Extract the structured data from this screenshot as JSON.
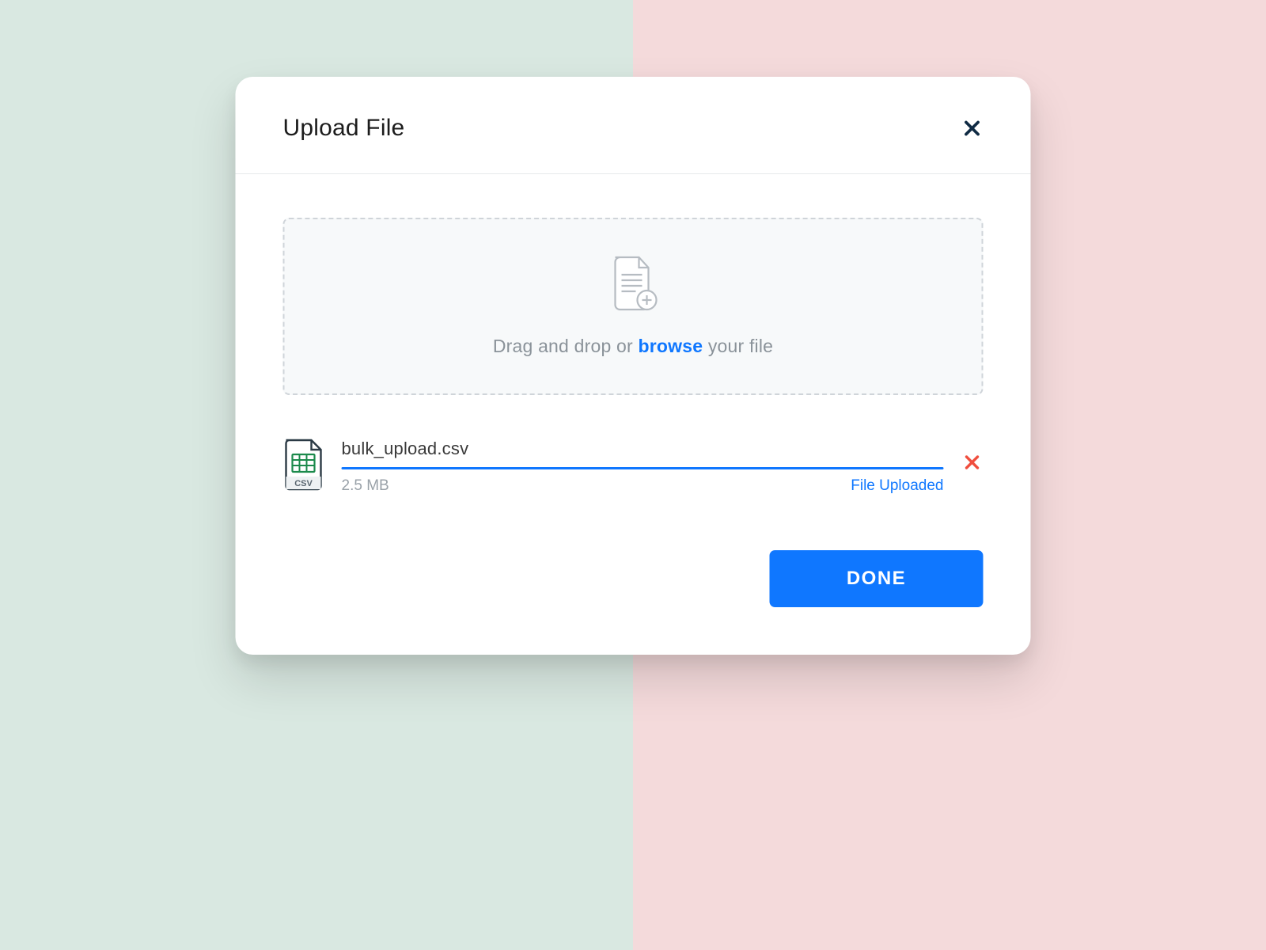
{
  "modal": {
    "title": "Upload File",
    "dropzone": {
      "text_before": "Drag and drop or ",
      "browse_label": "browse",
      "text_after": " your file"
    },
    "file": {
      "name": "bulk_upload.csv",
      "size": "2.5 MB",
      "status": "File Uploaded",
      "type_badge": "CSV",
      "progress_percent": 100
    },
    "done_label": "DONE"
  },
  "colors": {
    "accent": "#0f77ff",
    "danger": "#f04e3e",
    "bg_left": "#d9e8e1",
    "bg_right": "#f4dadb",
    "file_icon_green": "#1c8a4c"
  }
}
